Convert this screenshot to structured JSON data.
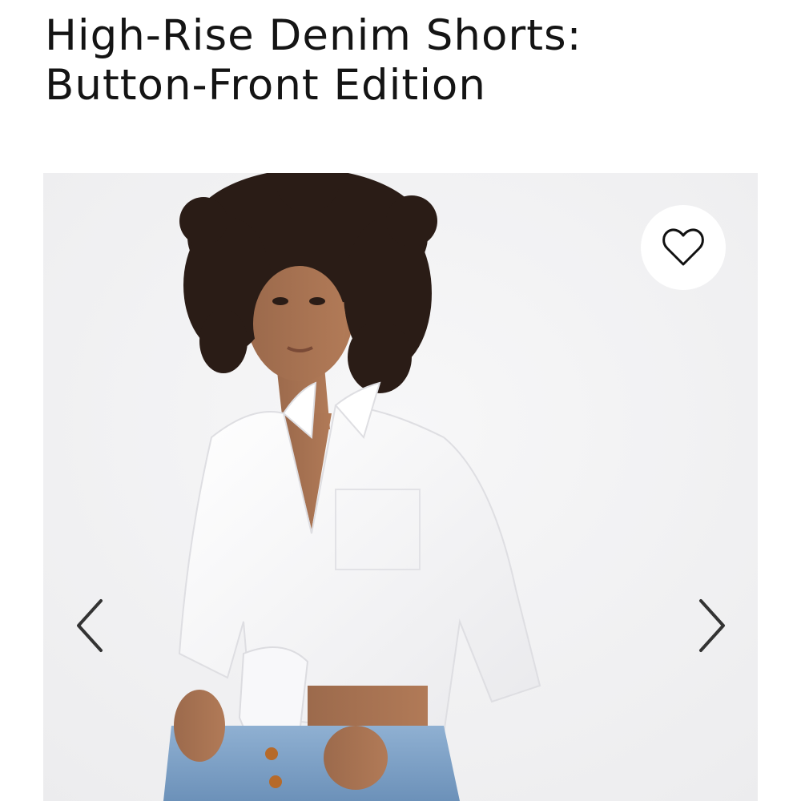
{
  "product": {
    "title_line1": "High-Rise Denim Shorts:",
    "title_line2": "Button-Front Edition"
  },
  "gallery": {
    "favorite_icon": "heart-outline-icon",
    "prev_icon": "chevron-left-icon",
    "next_icon": "chevron-right-icon"
  },
  "colors": {
    "text": "#141414",
    "photo_background": "#f2f2f3",
    "button_background": "#ffffff"
  }
}
